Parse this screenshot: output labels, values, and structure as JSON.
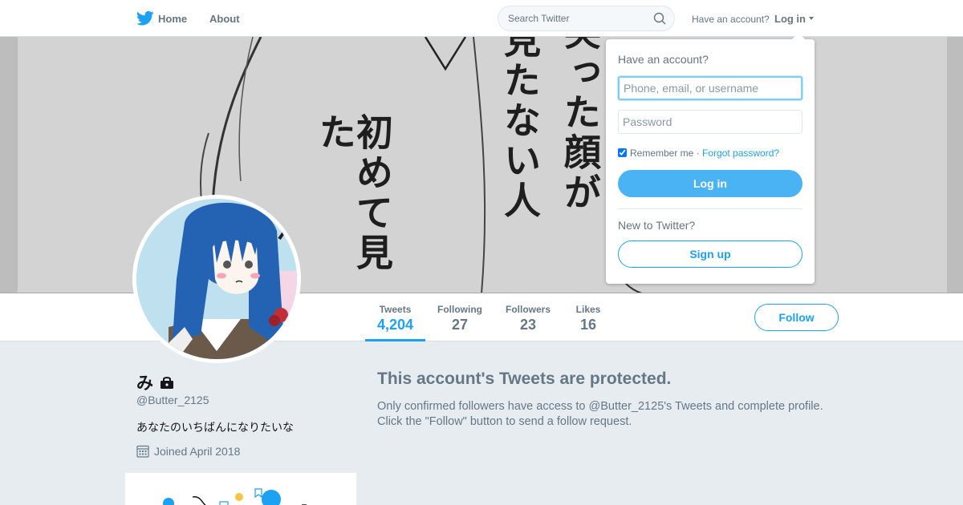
{
  "topbar": {
    "home": "Home",
    "about": "About",
    "search_placeholder": "Search Twitter",
    "have_account": "Have an account?",
    "login": "Log in"
  },
  "banner": {
    "columns": [
      "初めて見た",
      "笑った顔が",
      "見たない人"
    ]
  },
  "profile": {
    "display_name": "み",
    "handle": "@Butter_2125",
    "bio": "あなたのいちばんになりたいな",
    "joined": "Joined April 2018"
  },
  "stats": [
    {
      "label": "Tweets",
      "value": "4,204"
    },
    {
      "label": "Following",
      "value": "27"
    },
    {
      "label": "Followers",
      "value": "23"
    },
    {
      "label": "Likes",
      "value": "16"
    }
  ],
  "follow_button": "Follow",
  "protected": {
    "title": "This account's Tweets are protected.",
    "text": "Only confirmed followers have access to @Butter_2125's Tweets and complete profile. Click the \"Follow\" button to send a follow request."
  },
  "login_dropdown": {
    "title": "Have an account?",
    "username_placeholder": "Phone, email, or username",
    "password_placeholder": "Password",
    "remember": "Remember me",
    "separator": " · ",
    "forgot": "Forgot password?",
    "login_button": "Log in",
    "new_to": "New to Twitter?",
    "signup_button": "Sign up"
  },
  "colors": {
    "accent": "#1da1f2",
    "background": "#e6ecf0",
    "muted_text": "#657786"
  }
}
